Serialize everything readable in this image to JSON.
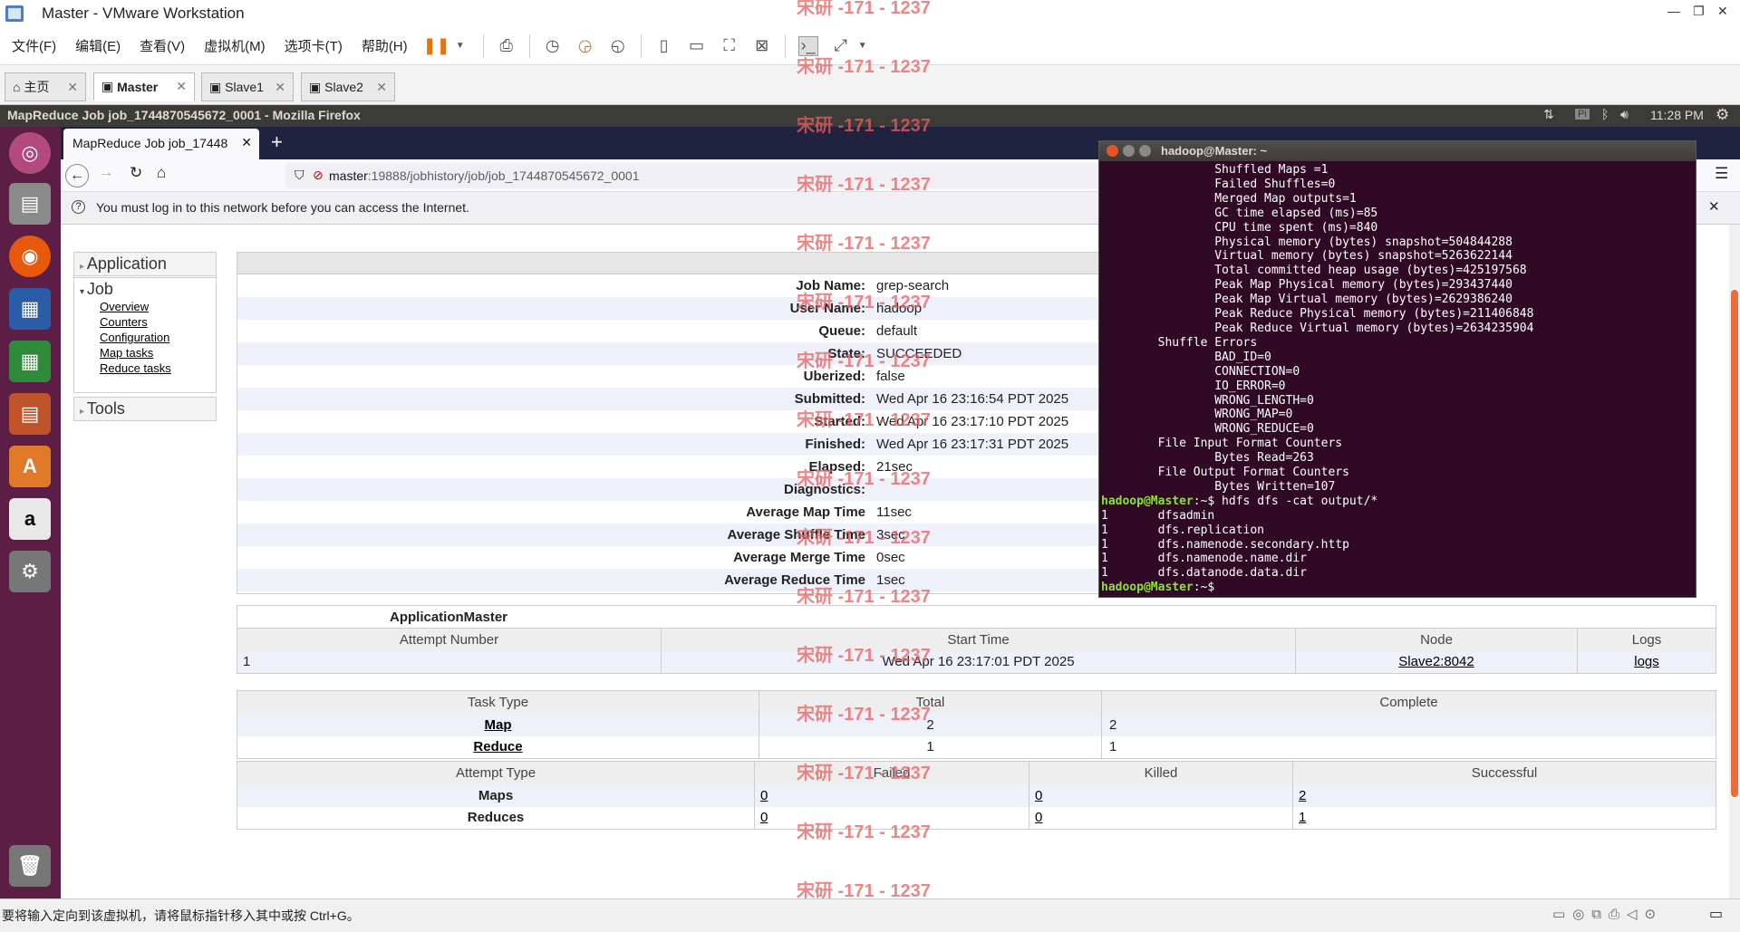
{
  "vmware": {
    "title": "Master - VMware Workstation",
    "menu": [
      "文件(F)",
      "编辑(E)",
      "查看(V)",
      "虚拟机(M)",
      "选项卡(T)",
      "帮助(H)"
    ],
    "tabs": [
      {
        "label": "主页"
      },
      {
        "label": "Master"
      },
      {
        "label": "Slave1"
      },
      {
        "label": "Slave2"
      }
    ],
    "status_text": "要将输入定向到该虚拟机，请将鼠标指针移入其中或按 Ctrl+G。"
  },
  "ubuntu": {
    "window_title": "MapReduce Job job_1744870545672_0001 - Mozilla Firefox",
    "time": "11:28 PM"
  },
  "firefox": {
    "tab_title": "MapReduce Job job_17448",
    "url_host": "master",
    "url_rest": ":19888/jobhistory/job/job_1744870545672_0001",
    "notice": "You must log in to this network before you can access the Internet."
  },
  "sidebar": {
    "application": "Application",
    "job": "Job",
    "job_links": [
      "Overview",
      "Counters",
      "Configuration",
      "Map tasks",
      "Reduce tasks"
    ],
    "tools": "Tools"
  },
  "job_info": [
    {
      "k": "Job Name:",
      "v": "grep-search"
    },
    {
      "k": "User Name:",
      "v": "hadoop"
    },
    {
      "k": "Queue:",
      "v": "default"
    },
    {
      "k": "State:",
      "v": "SUCCEEDED"
    },
    {
      "k": "Uberized:",
      "v": "false"
    },
    {
      "k": "Submitted:",
      "v": "Wed Apr 16 23:16:54 PDT 2025"
    },
    {
      "k": "Started:",
      "v": "Wed Apr 16 23:17:10 PDT 2025"
    },
    {
      "k": "Finished:",
      "v": "Wed Apr 16 23:17:31 PDT 2025"
    },
    {
      "k": "Elapsed:",
      "v": "21sec"
    },
    {
      "k": "Diagnostics:",
      "v": ""
    },
    {
      "k": "Average Map Time",
      "v": "11sec"
    },
    {
      "k": "Average Shuffle Time",
      "v": "3sec"
    },
    {
      "k": "Average Merge Time",
      "v": "0sec"
    },
    {
      "k": "Average Reduce Time",
      "v": "1sec"
    }
  ],
  "app_master": {
    "title": "ApplicationMaster",
    "headers": [
      "Attempt Number",
      "Start Time",
      "Node",
      "Logs"
    ],
    "row": {
      "attempt": "1",
      "start": "Wed Apr 16 23:17:01 PDT 2025",
      "node": "Slave2:8042",
      "logs": "logs"
    }
  },
  "tasks": {
    "headers": [
      "Task Type",
      "Total",
      "Complete"
    ],
    "rows": [
      {
        "type": "Map",
        "total": "2",
        "complete": "2"
      },
      {
        "type": "Reduce",
        "total": "1",
        "complete": "1"
      }
    ],
    "attempt_headers": [
      "Attempt Type",
      "Failed",
      "Killed",
      "Successful"
    ],
    "attempt_rows": [
      {
        "type": "Maps",
        "failed": "0",
        "killed": "0",
        "successful": "2"
      },
      {
        "type": "Reduces",
        "failed": "0",
        "killed": "0",
        "successful": "1"
      }
    ]
  },
  "terminal": {
    "title": "hadoop@Master: ~",
    "lines": [
      "                Shuffled Maps =1",
      "                Failed Shuffles=0",
      "                Merged Map outputs=1",
      "                GC time elapsed (ms)=85",
      "                CPU time spent (ms)=840",
      "                Physical memory (bytes) snapshot=504844288",
      "                Virtual memory (bytes) snapshot=5263622144",
      "                Total committed heap usage (bytes)=425197568",
      "                Peak Map Physical memory (bytes)=293437440",
      "                Peak Map Virtual memory (bytes)=2629386240",
      "                Peak Reduce Physical memory (bytes)=211406848",
      "                Peak Reduce Virtual memory (bytes)=2634235904",
      "        Shuffle Errors",
      "                BAD_ID=0",
      "                CONNECTION=0",
      "                IO_ERROR=0",
      "                WRONG_LENGTH=0",
      "                WRONG_MAP=0",
      "                WRONG_REDUCE=0",
      "        File Input Format Counters",
      "                Bytes Read=263",
      "        File Output Format Counters",
      "                Bytes Written=107"
    ],
    "prompt": "hadoop@Master",
    "command": ":~$ hdfs dfs -cat output/*",
    "output": [
      "1       dfsadmin",
      "1       dfs.replication",
      "1       dfs.namenode.secondary.http",
      "1       dfs.namenode.name.dir",
      "1       dfs.datanode.data.dir"
    ],
    "final_prompt_suffix": ":~$"
  },
  "watermark": "宋研 -171 - 1237"
}
